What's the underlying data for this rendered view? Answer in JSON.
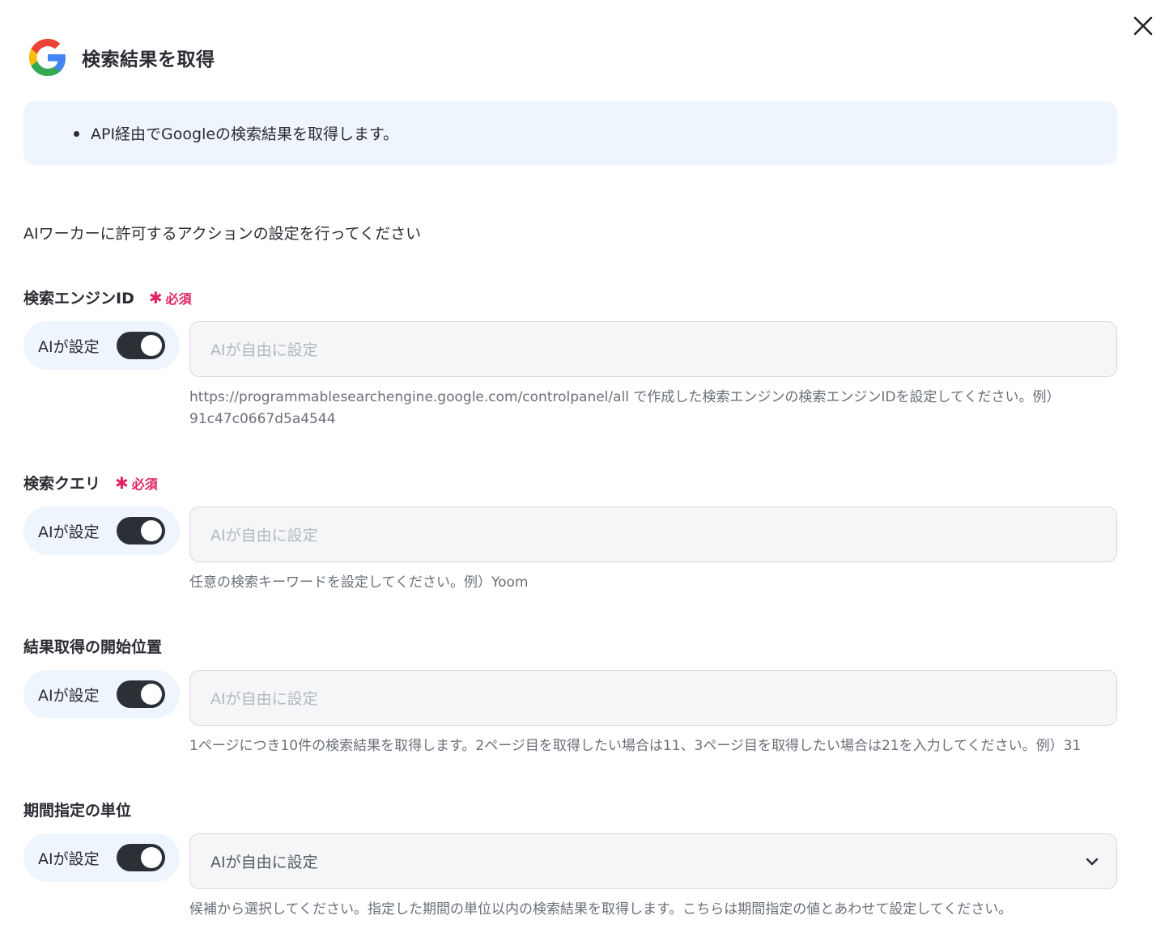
{
  "header": {
    "title": "検索結果を取得"
  },
  "info": {
    "items": [
      "API経由でGoogleの検索結果を取得します。"
    ]
  },
  "instruction": "AIワーカーに許可するアクションの設定を行ってください",
  "fields": [
    {
      "label": "検索エンジンID",
      "required": true,
      "required_label": "必須",
      "ai_label": "AIが設定",
      "ai_enabled": true,
      "placeholder": "AIが自由に設定",
      "help_line1": "https://programmablesearchengine.google.com/controlpanel/all で作成した検索エンジンの検索エンジンIDを設定してください。例）",
      "help_line2": "91c47c0667d5a4544"
    },
    {
      "label": "検索クエリ",
      "required": true,
      "required_label": "必須",
      "ai_label": "AIが設定",
      "ai_enabled": true,
      "placeholder": "AIが自由に設定",
      "help_line1": "任意の検索キーワードを設定してください。例）Yoom"
    },
    {
      "label": "結果取得の開始位置",
      "required": false,
      "ai_label": "AIが設定",
      "ai_enabled": true,
      "placeholder": "AIが自由に設定",
      "help_line1": "1ページにつき10件の検索結果を取得します。2ページ目を取得したい場合は11、3ページ目を取得したい場合は21を入力してください。例）31"
    },
    {
      "label": "期間指定の単位",
      "required": false,
      "ai_label": "AIが設定",
      "ai_enabled": true,
      "select_value": "AIが自由に設定",
      "help_line1": "候補から選択してください。指定した期間の単位以内の検索結果を取得します。こちらは期間指定の値とあわせて設定してください。"
    }
  ],
  "icons": {
    "close": "close-icon",
    "logo": "google-logo-icon",
    "dropdown": "chevron-down-icon"
  },
  "colors": {
    "info_bg": "#eef5fd",
    "required": "#e0245e",
    "toggle_on": "#2b2f36"
  }
}
